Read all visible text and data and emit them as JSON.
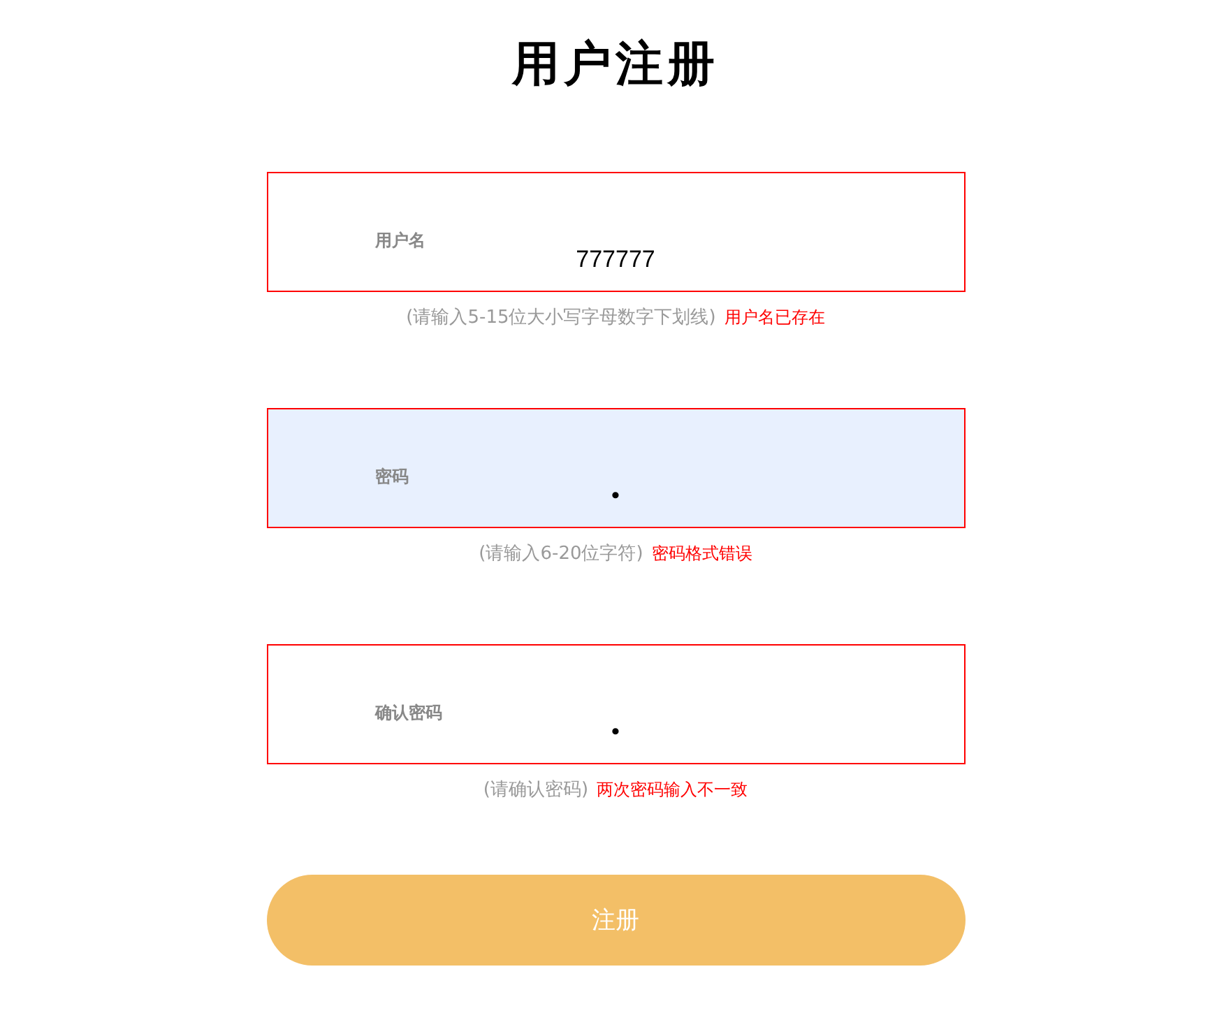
{
  "title": "用户注册",
  "fields": [
    {
      "label": "用户名",
      "value": "777777",
      "highlighted": false,
      "hint": "(请输入5-15位大小写字母数字下划线)",
      "error": "用户名已存在"
    },
    {
      "label": "密码",
      "value": "•",
      "highlighted": true,
      "hint": "(请输入6-20位字符)",
      "error": "密码格式错误"
    },
    {
      "label": "确认密码",
      "value": "•",
      "highlighted": false,
      "hint": "(请确认密码)",
      "error": "两次密码输入不一致"
    }
  ],
  "submit": "注册"
}
